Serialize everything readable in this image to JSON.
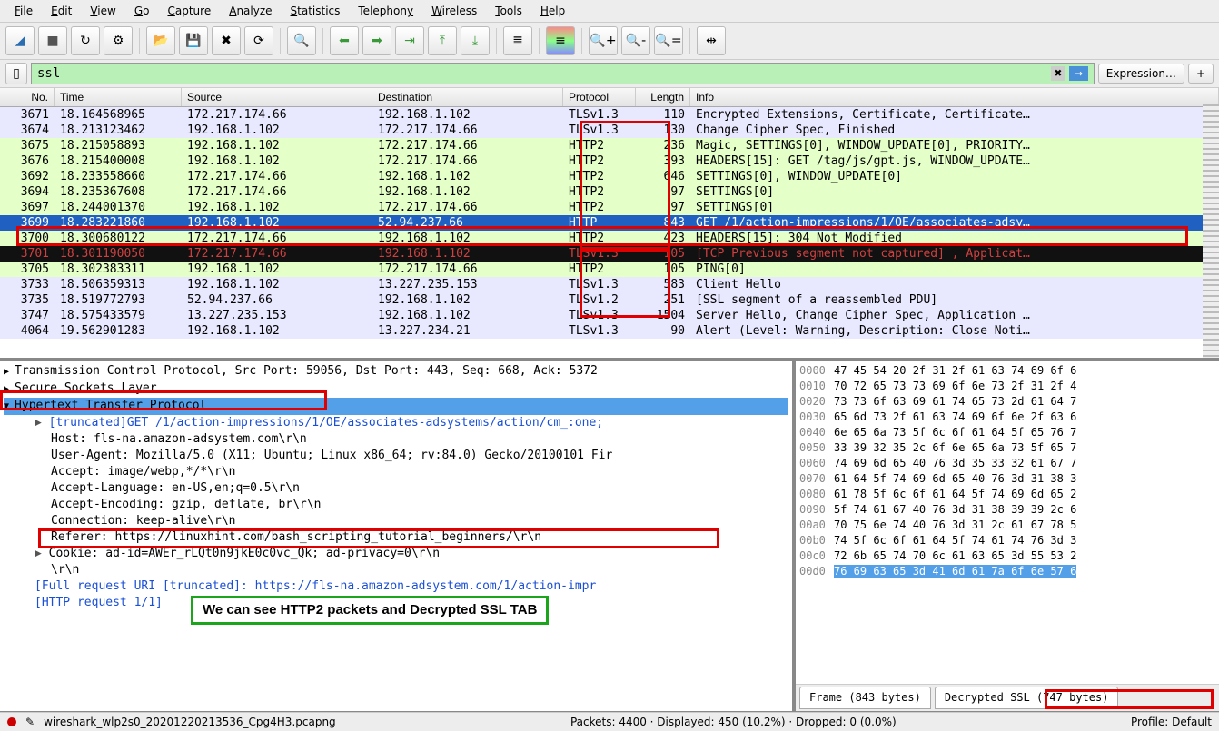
{
  "menu": [
    "File",
    "Edit",
    "View",
    "Go",
    "Capture",
    "Analyze",
    "Statistics",
    "Telephony",
    "Wireless",
    "Tools",
    "Help"
  ],
  "filter": {
    "value": "ssl",
    "expression_label": "Expression…"
  },
  "columns": [
    "No.",
    "Time",
    "Source",
    "Destination",
    "Protocol",
    "Length",
    "Info"
  ],
  "packets": [
    {
      "no": "3671",
      "time": "18.164568965",
      "src": "172.217.174.66",
      "dst": "192.168.1.102",
      "proto": "TLSv1.3",
      "len": "110",
      "info": "Encrypted Extensions, Certificate, Certificate…",
      "cls": "bg-lav"
    },
    {
      "no": "3674",
      "time": "18.213123462",
      "src": "192.168.1.102",
      "dst": "172.217.174.66",
      "proto": "TLSv1.3",
      "len": "130",
      "info": "Change Cipher Spec, Finished",
      "cls": "bg-lav"
    },
    {
      "no": "3675",
      "time": "18.215058893",
      "src": "192.168.1.102",
      "dst": "172.217.174.66",
      "proto": "HTTP2",
      "len": "236",
      "info": "Magic, SETTINGS[0], WINDOW_UPDATE[0], PRIORITY…",
      "cls": "bg-green"
    },
    {
      "no": "3676",
      "time": "18.215400008",
      "src": "192.168.1.102",
      "dst": "172.217.174.66",
      "proto": "HTTP2",
      "len": "393",
      "info": "HEADERS[15]: GET /tag/js/gpt.js, WINDOW_UPDATE…",
      "cls": "bg-green"
    },
    {
      "no": "3692",
      "time": "18.233558660",
      "src": "172.217.174.66",
      "dst": "192.168.1.102",
      "proto": "HTTP2",
      "len": "646",
      "info": "SETTINGS[0], WINDOW_UPDATE[0]",
      "cls": "bg-green"
    },
    {
      "no": "3694",
      "time": "18.235367608",
      "src": "172.217.174.66",
      "dst": "192.168.1.102",
      "proto": "HTTP2",
      "len": "97",
      "info": "SETTINGS[0]",
      "cls": "bg-green"
    },
    {
      "no": "3697",
      "time": "18.244001370",
      "src": "192.168.1.102",
      "dst": "172.217.174.66",
      "proto": "HTTP2",
      "len": "97",
      "info": "SETTINGS[0]",
      "cls": "bg-green"
    },
    {
      "no": "3699",
      "time": "18.283221860",
      "src": "192.168.1.102",
      "dst": "52.94.237.66",
      "proto": "HTTP",
      "len": "843",
      "info": "GET /1/action-impressions/1/OE/associates-adsy…",
      "cls": "bg-sel"
    },
    {
      "no": "3700",
      "time": "18.300680122",
      "src": "172.217.174.66",
      "dst": "192.168.1.102",
      "proto": "HTTP2",
      "len": "423",
      "info": "HEADERS[15]: 304 Not Modified",
      "cls": "bg-green"
    },
    {
      "no": "3701",
      "time": "18.301190050",
      "src": "172.217.174.66",
      "dst": "192.168.1.102",
      "proto": "TLSv1.3",
      "len": "105",
      "info": "[TCP Previous segment not captured] , Applicat…",
      "cls": "bg-black"
    },
    {
      "no": "3705",
      "time": "18.302383311",
      "src": "192.168.1.102",
      "dst": "172.217.174.66",
      "proto": "HTTP2",
      "len": "105",
      "info": "PING[0]",
      "cls": "bg-green"
    },
    {
      "no": "3733",
      "time": "18.506359313",
      "src": "192.168.1.102",
      "dst": "13.227.235.153",
      "proto": "TLSv1.3",
      "len": "583",
      "info": "Client Hello",
      "cls": "bg-lav"
    },
    {
      "no": "3735",
      "time": "18.519772793",
      "src": "52.94.237.66",
      "dst": "192.168.1.102",
      "proto": "TLSv1.2",
      "len": "251",
      "info": "[SSL segment of a reassembled PDU]",
      "cls": "bg-lav"
    },
    {
      "no": "3747",
      "time": "18.575433579",
      "src": "13.227.235.153",
      "dst": "192.168.1.102",
      "proto": "TLSv1.3",
      "len": "1504",
      "info": "Server Hello, Change Cipher Spec, Application …",
      "cls": "bg-lav"
    },
    {
      "no": "4064",
      "time": "19.562901283",
      "src": "192.168.1.102",
      "dst": "13.227.234.21",
      "proto": "TLSv1.3",
      "len": "90",
      "info": "Alert (Level: Warning, Description: Close Noti…",
      "cls": "bg-lav"
    }
  ],
  "details": {
    "line0": "Transmission Control Protocol, Src Port: 59056, Dst Port: 443, Seq: 668, Ack: 5372",
    "line1": "Secure Sockets Layer",
    "line2": "Hypertext Transfer Protocol",
    "lines": [
      "[truncated]GET /1/action-impressions/1/OE/associates-adsystems/action/cm_:one;",
      "Host: fls-na.amazon-adsystem.com\\r\\n",
      "User-Agent: Mozilla/5.0 (X11; Ubuntu; Linux x86_64; rv:84.0) Gecko/20100101 Fir",
      "Accept: image/webp,*/*\\r\\n",
      "Accept-Language: en-US,en;q=0.5\\r\\n",
      "Accept-Encoding: gzip, deflate, br\\r\\n",
      "Connection: keep-alive\\r\\n",
      "Referer: https://linuxhint.com/bash_scripting_tutorial_beginners/\\r\\n",
      "Cookie: ad-id=AWEr_rLQt0n9jkE0c0vc_Qk; ad-privacy=0\\r\\n",
      "\\r\\n",
      "[Full request URI [truncated]: https://fls-na.amazon-adsystem.com/1/action-impr",
      "[HTTP request 1/1]"
    ]
  },
  "hex": [
    {
      "off": "0000",
      "b": "47 45 54 20 2f 31 2f 61  63 74 69 6f 6"
    },
    {
      "off": "0010",
      "b": "70 72 65 73 73 69 6f 6e  73 2f 31 2f 4"
    },
    {
      "off": "0020",
      "b": "73 73 6f 63 69 61 74 65  73 2d 61 64 7"
    },
    {
      "off": "0030",
      "b": "65 6d 73 2f 61 63 74 69  6f 6e 2f 63 6"
    },
    {
      "off": "0040",
      "b": "6e 65 6a 73 5f 6c 6f 61  64 5f 65 76 7"
    },
    {
      "off": "0050",
      "b": "33 39 32 35 2c 6f 6e 65  6a 73 5f 65 7"
    },
    {
      "off": "0060",
      "b": "74 69 6d 65 40 76 3d 35  33 32 61 67 7"
    },
    {
      "off": "0070",
      "b": "61 64 5f 74 69 6d 65 40  76 3d 31 38 3"
    },
    {
      "off": "0080",
      "b": "61 78 5f 6c 6f 61 64 5f  74 69 6d 65 2"
    },
    {
      "off": "0090",
      "b": "5f 74 61 67 40 76 3d 31  38 39 39 2c 6"
    },
    {
      "off": "00a0",
      "b": "70 75 6e 74 40 76 3d 31  2c 61 67 78 5"
    },
    {
      "off": "00b0",
      "b": "74 5f 6c 6f 61 64 5f 74  61 74 76 3d 3"
    },
    {
      "off": "00c0",
      "b": "72 6b 65 74 70 6c 61 63  65 3d 55 53 2"
    },
    {
      "off": "00d0",
      "b": "76 69 63 65 3d 41 6d 61  7a 6f 6e 57 6"
    }
  ],
  "tabs": {
    "frame": "Frame (843 bytes)",
    "decrypted": "Decrypted SSL (747 bytes)"
  },
  "annotation": "We can see HTTP2 packets and Decrypted SSL TAB",
  "status": {
    "file": "wireshark_wlp2s0_20201220213536_Cpg4H3.pcapng",
    "center": "Packets: 4400 · Displayed: 450 (10.2%) · Dropped: 0 (0.0%)",
    "profile": "Profile: Default"
  }
}
